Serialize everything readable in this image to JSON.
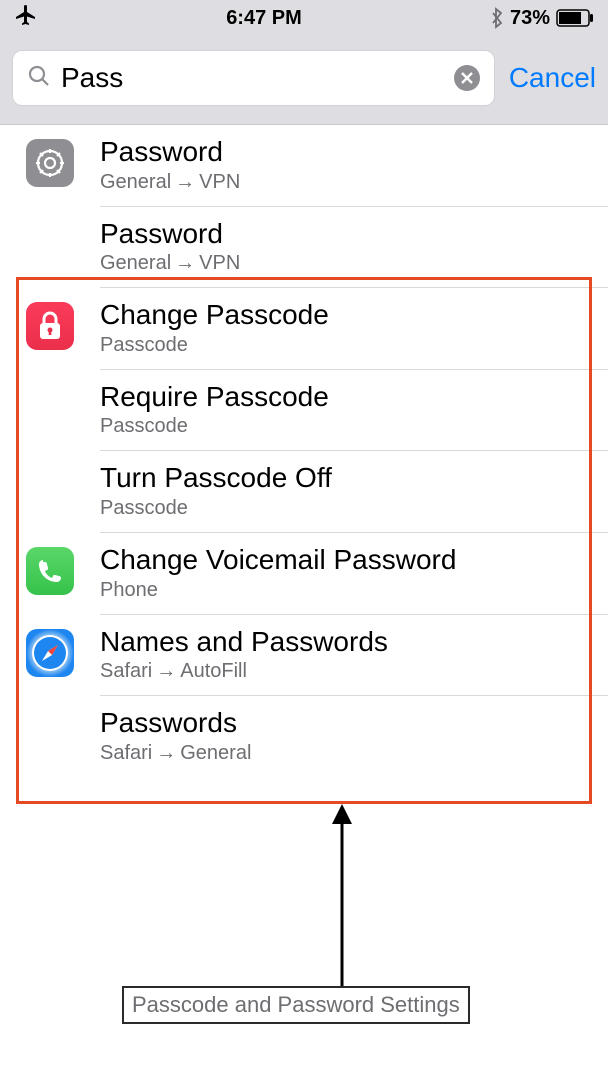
{
  "status": {
    "time": "6:47 PM",
    "battery_pct": "73%"
  },
  "search": {
    "value": "Pass",
    "cancel": "Cancel"
  },
  "results": [
    {
      "icon": "settings",
      "title": "Password",
      "path_a": "General",
      "path_b": "VPN"
    },
    {
      "icon": "",
      "title": "Password",
      "path_a": "General",
      "path_b": "VPN"
    },
    {
      "icon": "lock",
      "title": "Change Passcode",
      "path_a": "Passcode",
      "path_b": ""
    },
    {
      "icon": "",
      "title": "Require Passcode",
      "path_a": "Passcode",
      "path_b": ""
    },
    {
      "icon": "",
      "title": "Turn Passcode Off",
      "path_a": "Passcode",
      "path_b": ""
    },
    {
      "icon": "phone",
      "title": "Change Voicemail Password",
      "path_a": "Phone",
      "path_b": ""
    },
    {
      "icon": "safari",
      "title": "Names and Passwords",
      "path_a": "Safari",
      "path_b": "AutoFill"
    },
    {
      "icon": "",
      "title": "Passwords",
      "path_a": "Safari",
      "path_b": "General"
    }
  ],
  "annotation": {
    "label": "Passcode and Password Settings"
  },
  "arrow_glyph": "→"
}
